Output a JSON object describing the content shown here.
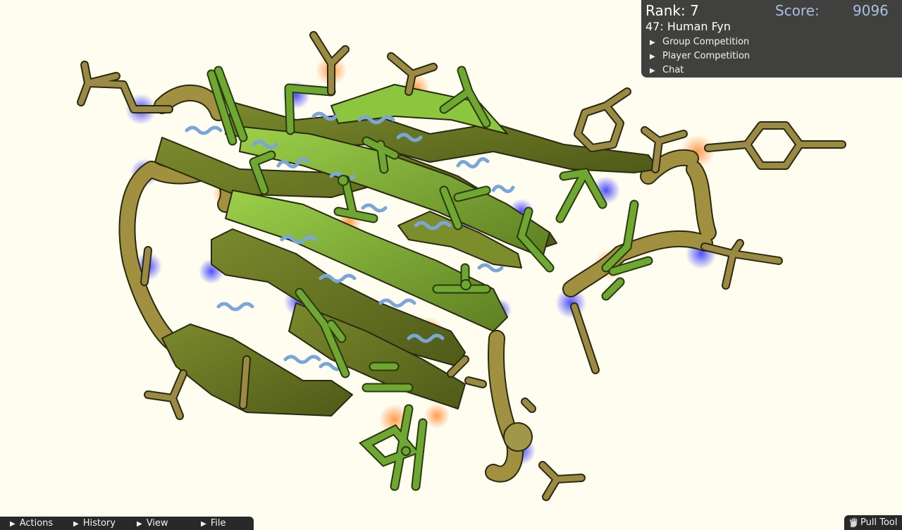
{
  "panel": {
    "rank": "Rank: 7",
    "score_label": "Score:",
    "score_value": "9096",
    "puzzle_title": "47: Human Fyn",
    "rows": {
      "group": "Group Competition",
      "player": "Player Competition",
      "chat": "Chat"
    }
  },
  "menu": {
    "actions": "Actions",
    "history": "History",
    "view": "View",
    "file": "File"
  },
  "tools": {
    "pull": "Pull Tool",
    "pull_icon": "hand-icon"
  },
  "colors": {
    "background": "#fffdf0",
    "strand_bright": "#8cc63f",
    "strand_dark": "#6e7a22",
    "backbone": "#a09040",
    "sidechain_green": "#6ea832",
    "sidechain_olive": "#9a8a44",
    "hbond": "#7aa6d8",
    "exposed_hydrophobic": "#ff9a40",
    "polar_glow": "#3c3cff",
    "panel_bg": "#303030",
    "score_text": "#a8c0e0"
  }
}
